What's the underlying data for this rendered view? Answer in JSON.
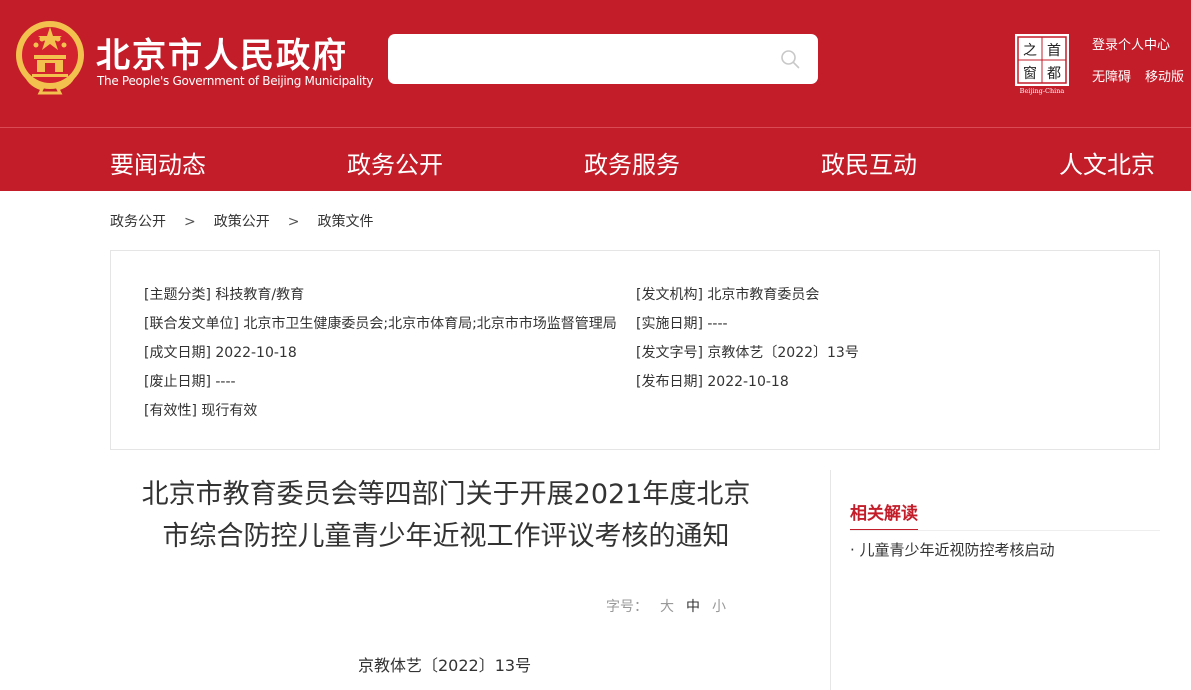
{
  "header": {
    "site_title": "北京市人民政府",
    "site_subtitle": "The People's Government of Beijing Municipality",
    "search_placeholder": "",
    "login_link": "登录个人中心",
    "accessibility_link": "无障碍",
    "mobile_link": "移动版",
    "capital_logo_chars": [
      "首",
      "都",
      "之",
      "窗"
    ],
    "capital_logo_caption": "Beijing-China"
  },
  "nav": {
    "items": [
      "要闻动态",
      "政务公开",
      "政务服务",
      "政民互动",
      "人文北京"
    ]
  },
  "breadcrumb": {
    "items": [
      "政务公开",
      "政策公开",
      "政策文件"
    ],
    "separator": ">"
  },
  "info": {
    "topic": "[主题分类] 科技教育/教育",
    "issuer": "[发文机构] 北京市教育委员会",
    "co_issuers": "[联合发文单位] 北京市卫生健康委员会;北京市体育局;北京市市场监督管理局",
    "effective_date": "[实施日期] ----",
    "written_date": "[成文日期] 2022-10-18",
    "doc_no": "[发文字号] 京教体艺〔2022〕13号",
    "repeal_date": "[废止日期] ----",
    "publish_date": "[发布日期] 2022-10-18",
    "validity": "[有效性] 现行有效"
  },
  "document": {
    "title_line1": "北京市教育委员会等四部门关于开展2021年度北京",
    "title_line2": "市综合防控儿童青少年近视工作评议考核的通知",
    "font_size_label": "字号：",
    "font_size_large": "大",
    "font_size_medium": "中",
    "font_size_small": "小",
    "doc_number": "京教体艺〔2022〕13号"
  },
  "sidebar": {
    "title": "相关解读",
    "items": [
      "· 儿童青少年近视防控考核启动"
    ]
  },
  "colors": {
    "brand_red": "#c31d2a",
    "gold": "#f2c14e"
  }
}
